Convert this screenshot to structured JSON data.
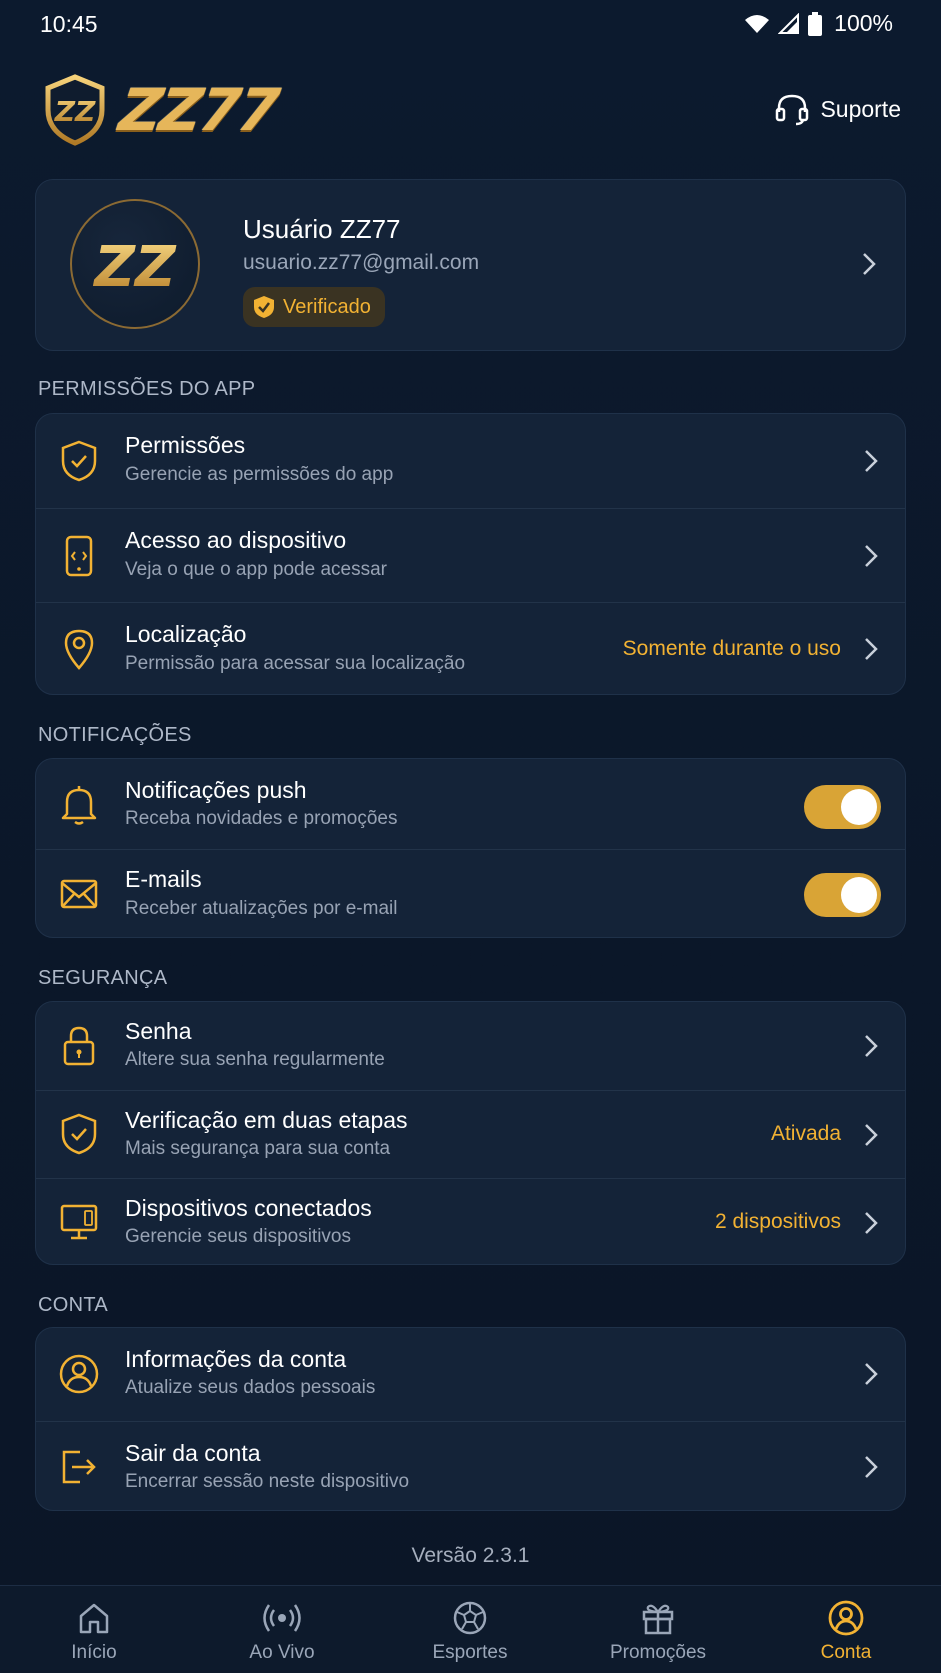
{
  "status_bar": {
    "time": "10:45",
    "battery": "100%"
  },
  "header": {
    "brand": "ZZ77",
    "support_label": "Suporte"
  },
  "profile": {
    "name": "Usuário ZZ77",
    "email": "usuario.zz77@gmail.com",
    "badge": "Verificado",
    "avatar_text": "ZZ"
  },
  "sections": {
    "permissions": {
      "title": "PERMISSÕES DO APP",
      "items": [
        {
          "title": "Permissões",
          "subtitle": "Gerencie as permissões do app",
          "value": ""
        },
        {
          "title": "Acesso ao dispositivo",
          "subtitle": "Veja o que o app pode acessar",
          "value": ""
        },
        {
          "title": "Localização",
          "subtitle": "Permissão para acessar sua localização",
          "value": "Somente durante o uso"
        }
      ]
    },
    "notifications": {
      "title": "NOTIFICAÇÕES",
      "items": [
        {
          "title": "Notificações push",
          "subtitle": "Receba novidades e promoções",
          "enabled": true
        },
        {
          "title": "E-mails",
          "subtitle": "Receber atualizações por e-mail",
          "enabled": true
        }
      ]
    },
    "security": {
      "title": "SEGURANÇA",
      "items": [
        {
          "title": "Senha",
          "subtitle": "Altere sua senha regularmente",
          "value": ""
        },
        {
          "title": "Verificação em duas etapas",
          "subtitle": "Mais segurança para sua conta",
          "value": "Ativada"
        },
        {
          "title": "Dispositivos conectados",
          "subtitle": "Gerencie seus dispositivos",
          "value": "2 dispositivos"
        }
      ]
    },
    "account": {
      "title": "CONTA",
      "items": [
        {
          "title": "Informações da conta",
          "subtitle": "Atualize seus dados pessoais"
        },
        {
          "title": "Sair da conta",
          "subtitle": "Encerrar sessão neste dispositivo"
        }
      ]
    }
  },
  "version": "Versão 2.3.1",
  "bottom_nav": [
    {
      "label": "Início",
      "icon": "home-icon",
      "active": false
    },
    {
      "label": "Ao Vivo",
      "icon": "live-broadcast-icon",
      "active": false
    },
    {
      "label": "Esportes",
      "icon": "soccer-ball-icon",
      "active": false
    },
    {
      "label": "Promoções",
      "icon": "gift-icon",
      "active": false
    },
    {
      "label": "Conta",
      "icon": "user-icon",
      "active": true
    }
  ],
  "colors": {
    "accent": "#f2b233",
    "background": "#0c1a2e",
    "card": "#142338",
    "muted_text": "#98a3b4"
  }
}
